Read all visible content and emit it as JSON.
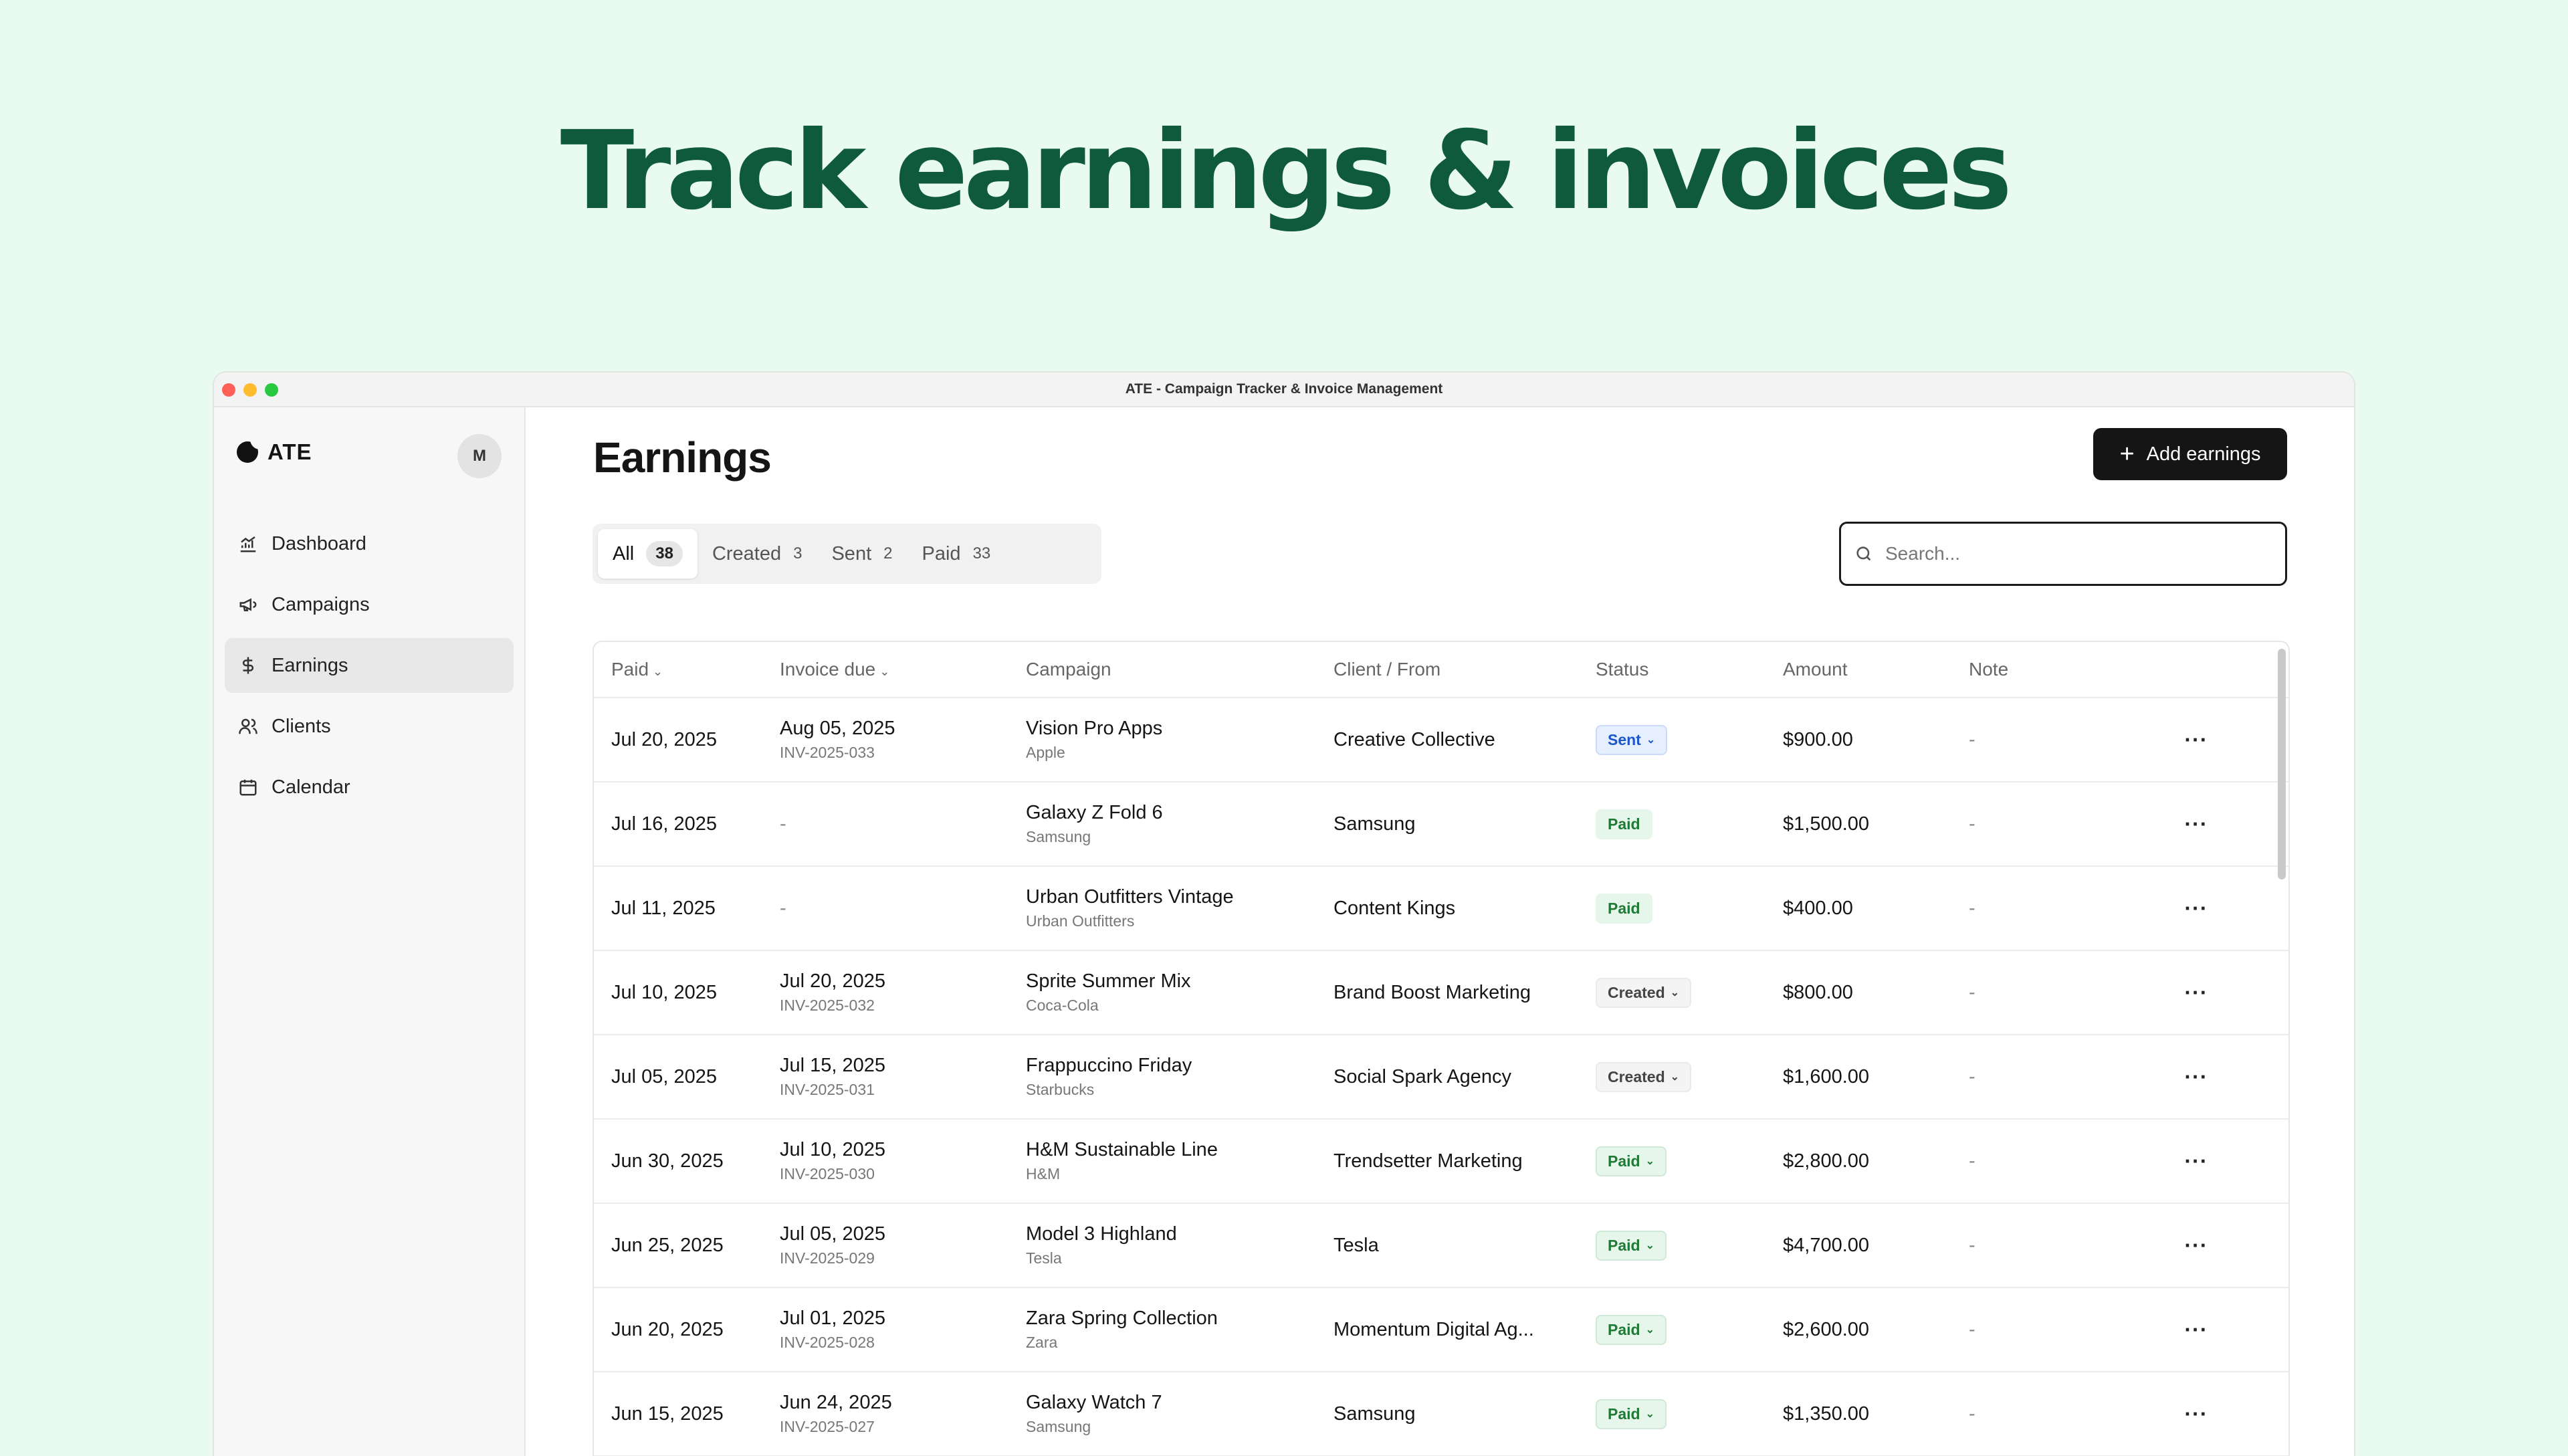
{
  "hero": {
    "title": "Track earnings & invoices"
  },
  "window": {
    "title": "ATE - Campaign Tracker & Invoice Management"
  },
  "sidebar": {
    "brand": "ATE",
    "avatar": "M",
    "items": [
      {
        "label": "Dashboard",
        "icon": "chart-icon"
      },
      {
        "label": "Campaigns",
        "icon": "megaphone-icon"
      },
      {
        "label": "Earnings",
        "icon": "dollar-icon",
        "active": true
      },
      {
        "label": "Clients",
        "icon": "users-icon"
      },
      {
        "label": "Calendar",
        "icon": "calendar-icon"
      }
    ]
  },
  "main": {
    "title": "Earnings",
    "add_button": "Add earnings",
    "tabs": [
      {
        "label": "All",
        "count": "38"
      },
      {
        "label": "Created",
        "count": "3"
      },
      {
        "label": "Sent",
        "count": "2"
      },
      {
        "label": "Paid",
        "count": "33"
      }
    ],
    "search_placeholder": "Search..."
  },
  "table": {
    "headers": [
      "Paid",
      "Invoice due",
      "Campaign",
      "Client / From",
      "Status",
      "Amount",
      "Note"
    ],
    "rows": [
      {
        "paid": "Jul 20, 2025",
        "due": "Aug 05, 2025",
        "invoice": "INV-2025-033",
        "campaign": "Vision Pro Apps",
        "brand": "Apple",
        "client": "Creative Collective",
        "status": "Sent",
        "amount": "$900.00",
        "note": "-"
      },
      {
        "paid": "Jul 16, 2025",
        "due": "-",
        "invoice": "",
        "campaign": "Galaxy Z Fold 6",
        "brand": "Samsung",
        "client": "Samsung",
        "status": "Paid",
        "amount": "$1,500.00",
        "note": "-"
      },
      {
        "paid": "Jul 11, 2025",
        "due": "-",
        "invoice": "",
        "campaign": "Urban Outfitters Vintage",
        "brand": "Urban Outfitters",
        "client": "Content Kings",
        "status": "Paid",
        "amount": "$400.00",
        "note": "-"
      },
      {
        "paid": "Jul 10, 2025",
        "due": "Jul 20, 2025",
        "invoice": "INV-2025-032",
        "campaign": "Sprite Summer Mix",
        "brand": "Coca-Cola",
        "client": "Brand Boost Marketing",
        "status": "Created",
        "amount": "$800.00",
        "note": "-"
      },
      {
        "paid": "Jul 05, 2025",
        "due": "Jul 15, 2025",
        "invoice": "INV-2025-031",
        "campaign": "Frappuccino Friday",
        "brand": "Starbucks",
        "client": "Social Spark Agency",
        "status": "Created",
        "amount": "$1,600.00",
        "note": "-"
      },
      {
        "paid": "Jun 30, 2025",
        "due": "Jul 10, 2025",
        "invoice": "INV-2025-030",
        "campaign": "H&M Sustainable Line",
        "brand": "H&M",
        "client": "Trendsetter Marketing",
        "status": "Paid",
        "amount": "$2,800.00",
        "note": "-"
      },
      {
        "paid": "Jun 25, 2025",
        "due": "Jul 05, 2025",
        "invoice": "INV-2025-029",
        "campaign": "Model 3 Highland",
        "brand": "Tesla",
        "client": "Tesla",
        "status": "Paid",
        "amount": "$4,700.00",
        "note": "-"
      },
      {
        "paid": "Jun 20, 2025",
        "due": "Jul 01, 2025",
        "invoice": "INV-2025-028",
        "campaign": "Zara Spring Collection",
        "brand": "Zara",
        "client": "Momentum Digital Ag...",
        "status": "Paid",
        "amount": "$2,600.00",
        "note": "-"
      },
      {
        "paid": "Jun 15, 2025",
        "due": "Jun 24, 2025",
        "invoice": "INV-2025-027",
        "campaign": "Galaxy Watch 7",
        "brand": "Samsung",
        "client": "Samsung",
        "status": "Paid",
        "amount": "$1,350.00",
        "note": "-"
      }
    ]
  }
}
